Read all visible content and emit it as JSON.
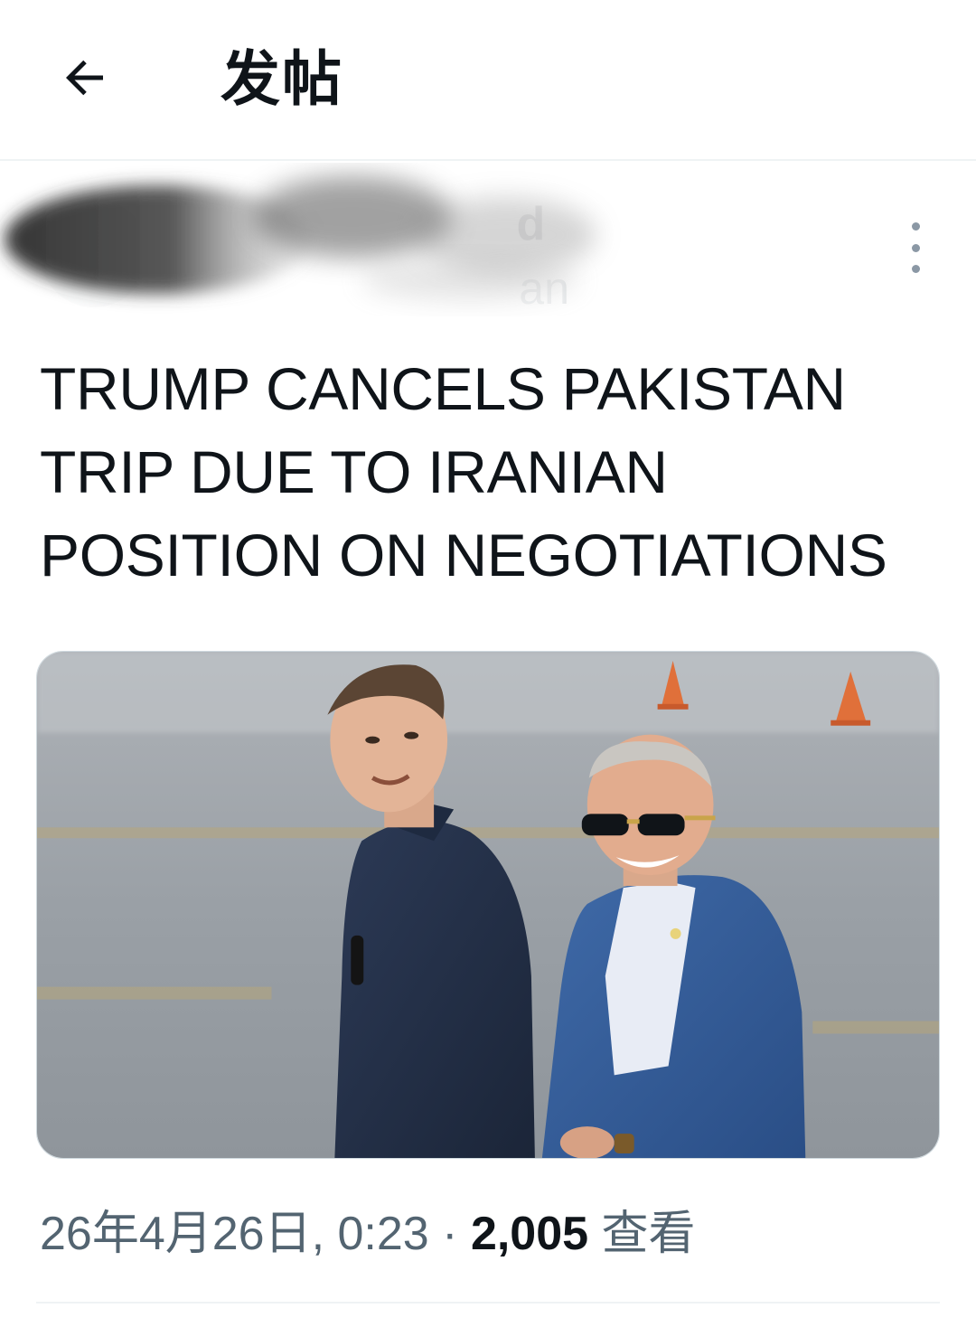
{
  "header": {
    "title": "发帖",
    "back_icon": "arrow-left-icon"
  },
  "author": {
    "display_name_visible": "d",
    "handle_visible": "an",
    "more_icon": "more-vertical-icon"
  },
  "post": {
    "text_lines": [
      "TRUMP CANCELS PAKISTAN",
      "TRIP DUE TO IRANIAN",
      "POSITION ON NEGOTIATIONS"
    ]
  },
  "meta": {
    "timestamp": "26年4月26日, 0:23",
    "separator": "·",
    "views_count": "2,005",
    "views_label": "查看"
  },
  "colors": {
    "text_primary": "#0f1419",
    "text_secondary": "#536471",
    "divider": "#eff3f4"
  }
}
